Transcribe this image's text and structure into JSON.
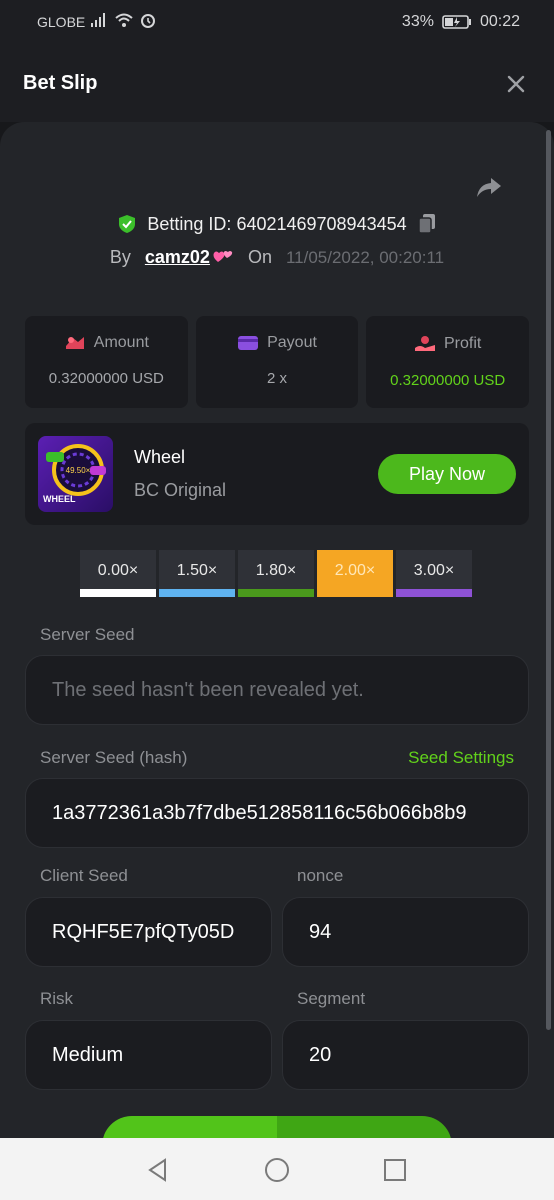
{
  "status_bar": {
    "carrier": "GLOBE",
    "battery": "33%",
    "time": "00:22"
  },
  "header": {
    "title": "Bet Slip"
  },
  "bet": {
    "betting_id_label": "Betting ID:",
    "betting_id": "64021469708943454",
    "by_label": "By",
    "username": "camz02",
    "on_label": "On",
    "date": "11/05/2022, 00:20:11"
  },
  "stats": [
    {
      "label": "Amount",
      "value": "0.32000000 USD"
    },
    {
      "label": "Payout",
      "value": "2 x"
    },
    {
      "label": "Profit",
      "value": "0.32000000 USD"
    }
  ],
  "game": {
    "name": "Wheel",
    "provider": "BC Original",
    "thumb_text": "WHEEL",
    "thumb_center": "49.50×",
    "play_label": "Play Now"
  },
  "multipliers": [
    {
      "label": "0.00×",
      "color": "#ffffff"
    },
    {
      "label": "1.50×",
      "color": "#5fb3f0"
    },
    {
      "label": "1.80×",
      "color": "#4a9a1c"
    },
    {
      "label": "2.00×",
      "color": "#f5a623"
    },
    {
      "label": "3.00×",
      "color": "#8e52d6"
    }
  ],
  "selected_multiplier": "2.00×",
  "fields": {
    "server_seed_label": "Server Seed",
    "server_seed_placeholder": "The seed hasn't been revealed yet.",
    "server_seed_hash_label": "Server Seed (hash)",
    "seed_settings_label": "Seed Settings",
    "server_seed_hash": "1a3772361a3b7f7dbe512858116c56b066b8b9",
    "client_seed_label": "Client Seed",
    "client_seed": "RQHF5E7pfQTy05D",
    "nonce_label": "nonce",
    "nonce": "94",
    "risk_label": "Risk",
    "risk": "Medium",
    "segment_label": "Segment",
    "segment": "20"
  },
  "colors": {
    "accent_green": "#62d21b",
    "button_green": "#4cb81c",
    "highlight_orange": "#f5a623",
    "panel_bg": "#232529"
  }
}
